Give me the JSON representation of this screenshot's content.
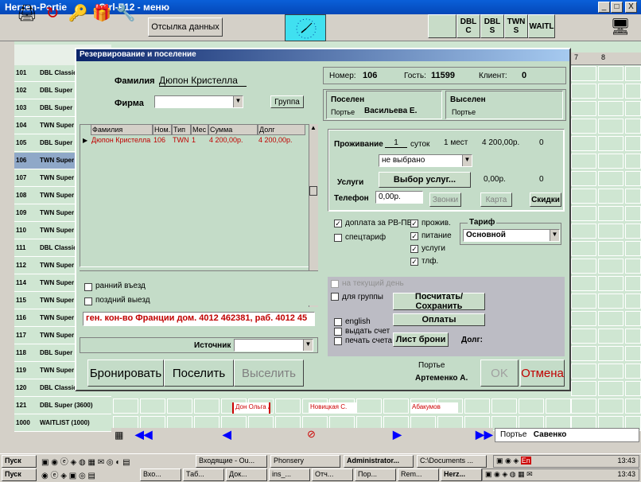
{
  "window": {
    "title": "Herzen-Portie",
    "subtitle": "Ctrl-F12 - меню",
    "min_btn": "_",
    "max_btn": "□",
    "close_btn": "X"
  },
  "toolbar": {
    "send_button": "Отсылка данных",
    "room_type_buttons": [
      "DBL C",
      "DBL S",
      "TWN S",
      "WAITL"
    ]
  },
  "calendar_headers": [
    "7",
    "8"
  ],
  "rooms": [
    {
      "num": "101",
      "type": "DBL Classic"
    },
    {
      "num": "102",
      "type": "DBL Super"
    },
    {
      "num": "103",
      "type": "DBL Super"
    },
    {
      "num": "104",
      "type": "TWN Super"
    },
    {
      "num": "105",
      "type": "DBL Super"
    },
    {
      "num": "106",
      "type": "TWN Super"
    },
    {
      "num": "107",
      "type": "TWN Super"
    },
    {
      "num": "108",
      "type": "TWN Super"
    },
    {
      "num": "109",
      "type": "TWN Super"
    },
    {
      "num": "110",
      "type": "TWN Super"
    },
    {
      "num": "111",
      "type": "DBL Classic"
    },
    {
      "num": "112",
      "type": "TWN Super"
    },
    {
      "num": "114",
      "type": "TWN Super"
    },
    {
      "num": "115",
      "type": "TWN Super"
    },
    {
      "num": "116",
      "type": "TWN Super"
    },
    {
      "num": "117",
      "type": "TWN Super"
    },
    {
      "num": "118",
      "type": "DBL Super"
    },
    {
      "num": "119",
      "type": "TWN Super"
    },
    {
      "num": "120",
      "type": "DBL Classic"
    },
    {
      "num": "121",
      "type": "DBL Super (3600)"
    },
    {
      "num": "1000",
      "type": "WAITLIST (1000)"
    }
  ],
  "bookings": [
    "Дон Ольга А.",
    "Новицкая С.",
    "Абакумов"
  ],
  "dialog": {
    "title": "Резервирование и поселение",
    "surname_label": "Фамилия",
    "surname_value": "Дюпон Кристелла",
    "firm_label": "Фирма",
    "firm_value": "",
    "group_button": "Группа",
    "grid_headers": [
      "Фамилия",
      "Ном.",
      "Тип",
      "Мес",
      "Сумма",
      "Долг"
    ],
    "grid_rows": [
      {
        "name": "Дюпон Кристелла",
        "room": "106",
        "type": "TWN",
        "places": "1",
        "sum": "4 200,00р.",
        "debt": "4 200,00р."
      }
    ],
    "early_checkin": "ранний въезд",
    "late_checkout": "поздний выезд",
    "note_text": "ген. кон-во Франции дом. 4012 462381, раб. 4012 45",
    "source_label": "Источник",
    "source_value": "",
    "number_label": "Номер:",
    "number_value": "106",
    "guest_label": "Гость:",
    "guest_value": "11599",
    "client_label": "Клиент:",
    "client_value": "0",
    "settled_label": "Поселен",
    "settled_by_label": "Портье",
    "settled_by_value": "Васильева Е.",
    "evicted_label": "Выселен",
    "evicted_by_label": "Портье",
    "stay_label": "Проживание",
    "stay_days": "1",
    "stay_unit": "суток",
    "stay_places": "1 мест",
    "stay_sum": "4 200,00р.",
    "stay_zero": "0",
    "stay_select": "не выбрано",
    "services_label": "Услуги",
    "services_button": "Выбор услуг...",
    "services_sum": "0,00р.",
    "services_zero": "0",
    "phone_label": "Телефон",
    "phone_value": "0,00р.",
    "calls_button": "Звонки",
    "card_button": "Карта",
    "discounts_button": "Скидки",
    "pay_rbpv": "доплата за РВ-ПВ",
    "special_tariff": "спецтариф",
    "opt_living": "прожив.",
    "opt_food": "питание",
    "opt_services": "услуги",
    "opt_phone": "тлф.",
    "tariff_label": "Тариф",
    "tariff_value": "Основной",
    "current_day": "на текущий день",
    "for_group": "для группы",
    "calc_save_button": "Посчитать/Сохранить",
    "payments_button": "Оплаты",
    "bill_sheet_button": "Лист брони",
    "english": "english",
    "issue_bill": "выдать счет",
    "print_bill": "печать счета",
    "debt_label": "Долг:",
    "book_button": "Бронировать",
    "settle_button": "Поселить",
    "evict_button": "Выселить",
    "porter_label": "Портье",
    "porter_value": "Артеменко А.",
    "ok_button": "OK",
    "cancel_button": "Отмена"
  },
  "nav": {
    "porter_label": "Портье",
    "porter_value": "Савенко"
  },
  "taskbar": {
    "start1": "Пуск",
    "start2": "Пуск",
    "row1": [
      "Входящие - Ou...",
      "Phonsery",
      "Administrator...",
      "C:\\Documents ..."
    ],
    "row2": [
      "Вхо...",
      "Таб...",
      "Док...",
      "ins_...",
      "Отч...",
      "Пор...",
      "Rem...",
      "Herz..."
    ],
    "time1": "13:43",
    "time2": "13:43",
    "lang": "En"
  },
  "colors": {
    "accent_blue": "#0a246a",
    "bg_green": "#c4dcc8",
    "cancel_red": "#c00000",
    "clock_cyan": "#40e0f0"
  }
}
